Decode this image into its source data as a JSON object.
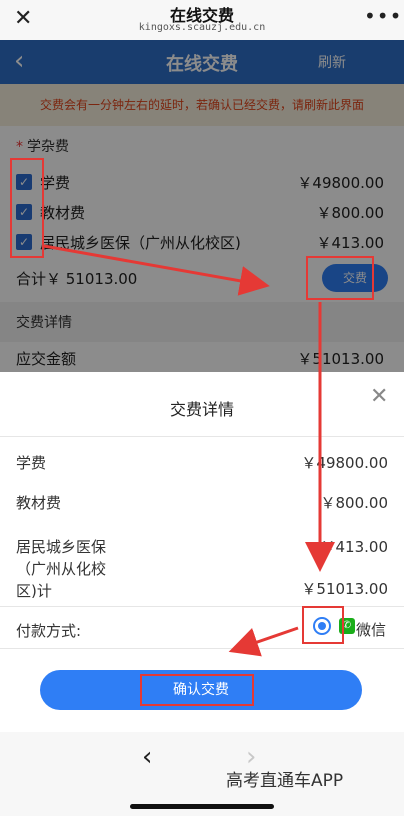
{
  "browser": {
    "title": "在线交费",
    "host": "kingoxs.scauzj.edu.cn"
  },
  "app": {
    "title": "在线交费",
    "refresh": "刷新"
  },
  "notice": "交费会有一分钟左右的延时，若确认已经交费，请刷新此界面",
  "fees": {
    "section_title": "学杂费",
    "items": [
      {
        "label": "学费",
        "amount": "￥49800.00"
      },
      {
        "label": "教材费",
        "amount": "￥800.00"
      },
      {
        "label": "居民城乡医保（广州从化校区)",
        "amount": "￥413.00"
      }
    ],
    "total": "合计￥ 51013.00",
    "pay_button": "交费"
  },
  "details": {
    "title": "交费详情",
    "due_label": "应交金额",
    "due_amount": "￥51013.00"
  },
  "sheet": {
    "title": "交费详情",
    "items": [
      {
        "label": "学费",
        "amount": "￥49800.00"
      },
      {
        "label": "教材费",
        "amount": "￥800.00"
      },
      {
        "label": "居民城乡医保",
        "label2": "（广州从化校",
        "label3": "区)计",
        "amount": "￥413.00"
      }
    ],
    "total_amount": "￥51013.00",
    "pay_method_label": "付款方式:",
    "pay_method": "微信",
    "confirm": "确认交费"
  },
  "watermark": "高考直通车APP",
  "icons": {
    "close": "close-icon",
    "more": "more-icon",
    "back": "chevron-left-icon",
    "wechat": "wechat-icon"
  },
  "colors": {
    "primary": "#2f7ef5",
    "header": "#2f6fc8",
    "annotation": "#e53935"
  }
}
